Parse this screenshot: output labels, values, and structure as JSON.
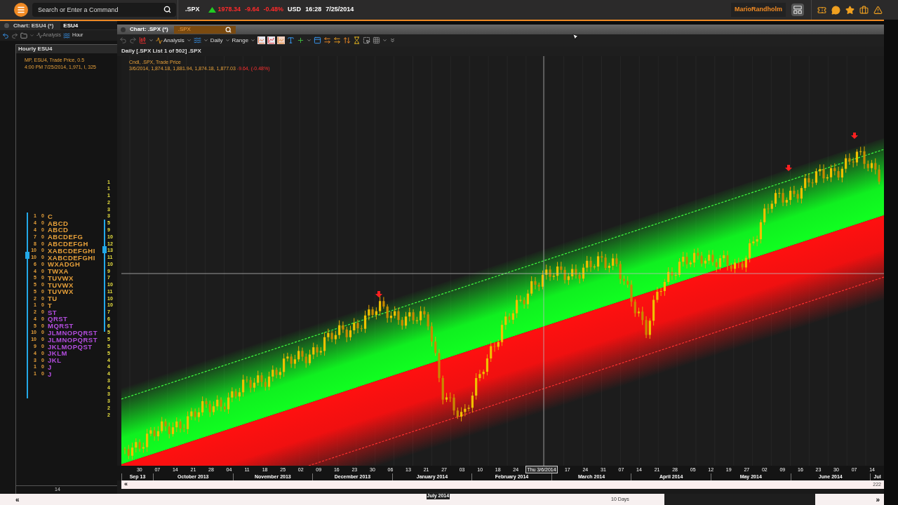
{
  "top_bar": {
    "search": {
      "placeholder": "Search or Enter a Command"
    },
    "ticker": {
      "symbol": ".SPX",
      "rising": true,
      "last": "1978.34",
      "change": "-9.64",
      "change_pct": "-0.48%"
    },
    "currency": "USD",
    "time": "16:28",
    "date": "7/25/2014",
    "user": "MarioRandholm"
  },
  "left_window": {
    "title": "Chart: ESU4 (*)",
    "symbol": "ESU4",
    "toolbar": [
      "Analysis",
      "Hour"
    ],
    "panel_title": "Hourly ESU4",
    "info": [
      "MP, ESU4, Trade Price, 0.5",
      "4:00 PM 7/25/2014, 1,971, I, 325"
    ],
    "profile_rows": [
      {
        "count": "1",
        "zero": "0",
        "letters": "C",
        "color": "#e8a13a"
      },
      {
        "count": "4",
        "zero": "0",
        "letters": "ABCD",
        "color": "#e8a13a"
      },
      {
        "count": "4",
        "zero": "0",
        "letters": "ABCD",
        "color": "#e8a13a"
      },
      {
        "count": "7",
        "zero": "0",
        "letters": "ABCDEFG",
        "color": "#e8a13a"
      },
      {
        "count": "8",
        "zero": "0",
        "letters": "ABCDEFGH",
        "color": "#e8a13a"
      },
      {
        "count": "10",
        "zero": "0",
        "letters": "XABCDEFGHI",
        "color": "#e8a13a"
      },
      {
        "count": "10",
        "zero": "0",
        "letters": "XABCDEFGHI",
        "color": "#e8a13a"
      },
      {
        "count": "6",
        "zero": "0",
        "letters": "WXADGH",
        "color": "#e8a13a"
      },
      {
        "count": "4",
        "zero": "0",
        "letters": "TWXA",
        "color": "#e8a13a"
      },
      {
        "count": "5",
        "zero": "0",
        "letters": "TUVWX",
        "color": "#e8a13a"
      },
      {
        "count": "5",
        "zero": "0",
        "letters": "TUVWX",
        "color": "#e8a13a"
      },
      {
        "count": "5",
        "zero": "0",
        "letters": "TUVWX",
        "color": "#e8a13a"
      },
      {
        "count": "2",
        "zero": "0",
        "letters": "TU",
        "color": "#e8a13a"
      },
      {
        "count": "1",
        "zero": "0",
        "letters": "T",
        "color": "#e8a13a"
      },
      {
        "count": "2",
        "zero": "0",
        "letters": "ST",
        "color": "#b44de0"
      },
      {
        "count": "4",
        "zero": "0",
        "letters": "QRST",
        "color": "#b44de0"
      },
      {
        "count": "5",
        "zero": "0",
        "letters": "MQRST",
        "color": "#b44de0"
      },
      {
        "count": "10",
        "zero": "0",
        "letters": "JLMNOPQRST",
        "color": "#b44de0"
      },
      {
        "count": "10",
        "zero": "0",
        "letters": "JLMNOPQRST",
        "color": "#b44de0"
      },
      {
        "count": "9",
        "zero": "0",
        "letters": "JKLMOPQST",
        "color": "#b44de0"
      },
      {
        "count": "4",
        "zero": "0",
        "letters": "JKLM",
        "color": "#b44de0"
      },
      {
        "count": "3",
        "zero": "0",
        "letters": "JKL",
        "color": "#b44de0"
      },
      {
        "count": "1",
        "zero": "0",
        "letters": "J",
        "color": "#b44de0"
      },
      {
        "count": "1",
        "zero": "0",
        "letters": "J",
        "color": "#b44de0"
      }
    ],
    "right_scale": [
      "1",
      "1",
      "1",
      "2",
      "3",
      "3",
      "5",
      "9",
      "10",
      "12",
      "13",
      "11",
      "10",
      "9",
      "7",
      "10",
      "11",
      "10",
      "10",
      "7",
      "6",
      "6",
      "5",
      "5",
      "5",
      "5",
      "4",
      "4",
      "4",
      "3",
      "4",
      "3",
      "3",
      "2",
      "2"
    ],
    "footer": "14"
  },
  "chart_window": {
    "title": "Chart: .SPX (*)",
    "symbol": ".SPX",
    "toolbar": [
      "Analysis",
      "Daily",
      "Range"
    ],
    "panel_title": "Daily [.SPX List 1 of 502] .SPX",
    "legend_title": "Cndl, .SPX, Trade Price",
    "legend_values": "3/6/2014, 1,874.18, 1,881.94, 1,874.18, 1,877.03",
    "legend_change": "-9.64, (-0.48%)",
    "days": [
      {
        "label": "30",
        "kind": "day"
      },
      {
        "label": "07",
        "kind": "day"
      },
      {
        "label": "14",
        "kind": "day"
      },
      {
        "label": "21",
        "kind": "day"
      },
      {
        "label": "28",
        "kind": "day"
      },
      {
        "label": "04",
        "kind": "day"
      },
      {
        "label": "11",
        "kind": "day"
      },
      {
        "label": "18",
        "kind": "day"
      },
      {
        "label": "25",
        "kind": "day"
      },
      {
        "label": "02",
        "kind": "day"
      },
      {
        "label": "09",
        "kind": "day"
      },
      {
        "label": "16",
        "kind": "day"
      },
      {
        "label": "23",
        "kind": "day"
      },
      {
        "label": "30",
        "kind": "day"
      },
      {
        "label": "06",
        "kind": "day"
      },
      {
        "label": "13",
        "kind": "day"
      },
      {
        "label": "21",
        "kind": "day"
      },
      {
        "label": "27",
        "kind": "day"
      },
      {
        "label": "03",
        "kind": "day"
      },
      {
        "label": "10",
        "kind": "day"
      },
      {
        "label": "18",
        "kind": "day"
      },
      {
        "label": "24",
        "kind": "day"
      },
      {
        "label": "Thu 3/6/2014",
        "kind": "crosshair"
      },
      {
        "label": "17",
        "kind": "day"
      },
      {
        "label": "24",
        "kind": "day"
      },
      {
        "label": "31",
        "kind": "day"
      },
      {
        "label": "07",
        "kind": "day"
      },
      {
        "label": "14",
        "kind": "day"
      },
      {
        "label": "21",
        "kind": "day"
      },
      {
        "label": "28",
        "kind": "day"
      },
      {
        "label": "05",
        "kind": "day"
      },
      {
        "label": "12",
        "kind": "day"
      },
      {
        "label": "19",
        "kind": "day"
      },
      {
        "label": "27",
        "kind": "day"
      },
      {
        "label": "02",
        "kind": "day"
      },
      {
        "label": "09",
        "kind": "day"
      },
      {
        "label": "16",
        "kind": "day"
      },
      {
        "label": "23",
        "kind": "day"
      },
      {
        "label": "30",
        "kind": "day"
      },
      {
        "label": "07",
        "kind": "day"
      },
      {
        "label": "14",
        "kind": "day"
      }
    ],
    "months": [
      "Sep 13",
      "October 2013",
      "November 2013",
      "December 2013",
      "January 2014",
      "February 2014",
      "March 2014",
      "April 2014",
      "May 2014",
      "June 2014",
      "Jul"
    ],
    "scroll": {
      "prev": "«",
      "count": "222"
    }
  },
  "bottom_bar": {
    "prev": "«",
    "period_label": "July 2014",
    "range": "10 Days",
    "next": "»"
  }
}
